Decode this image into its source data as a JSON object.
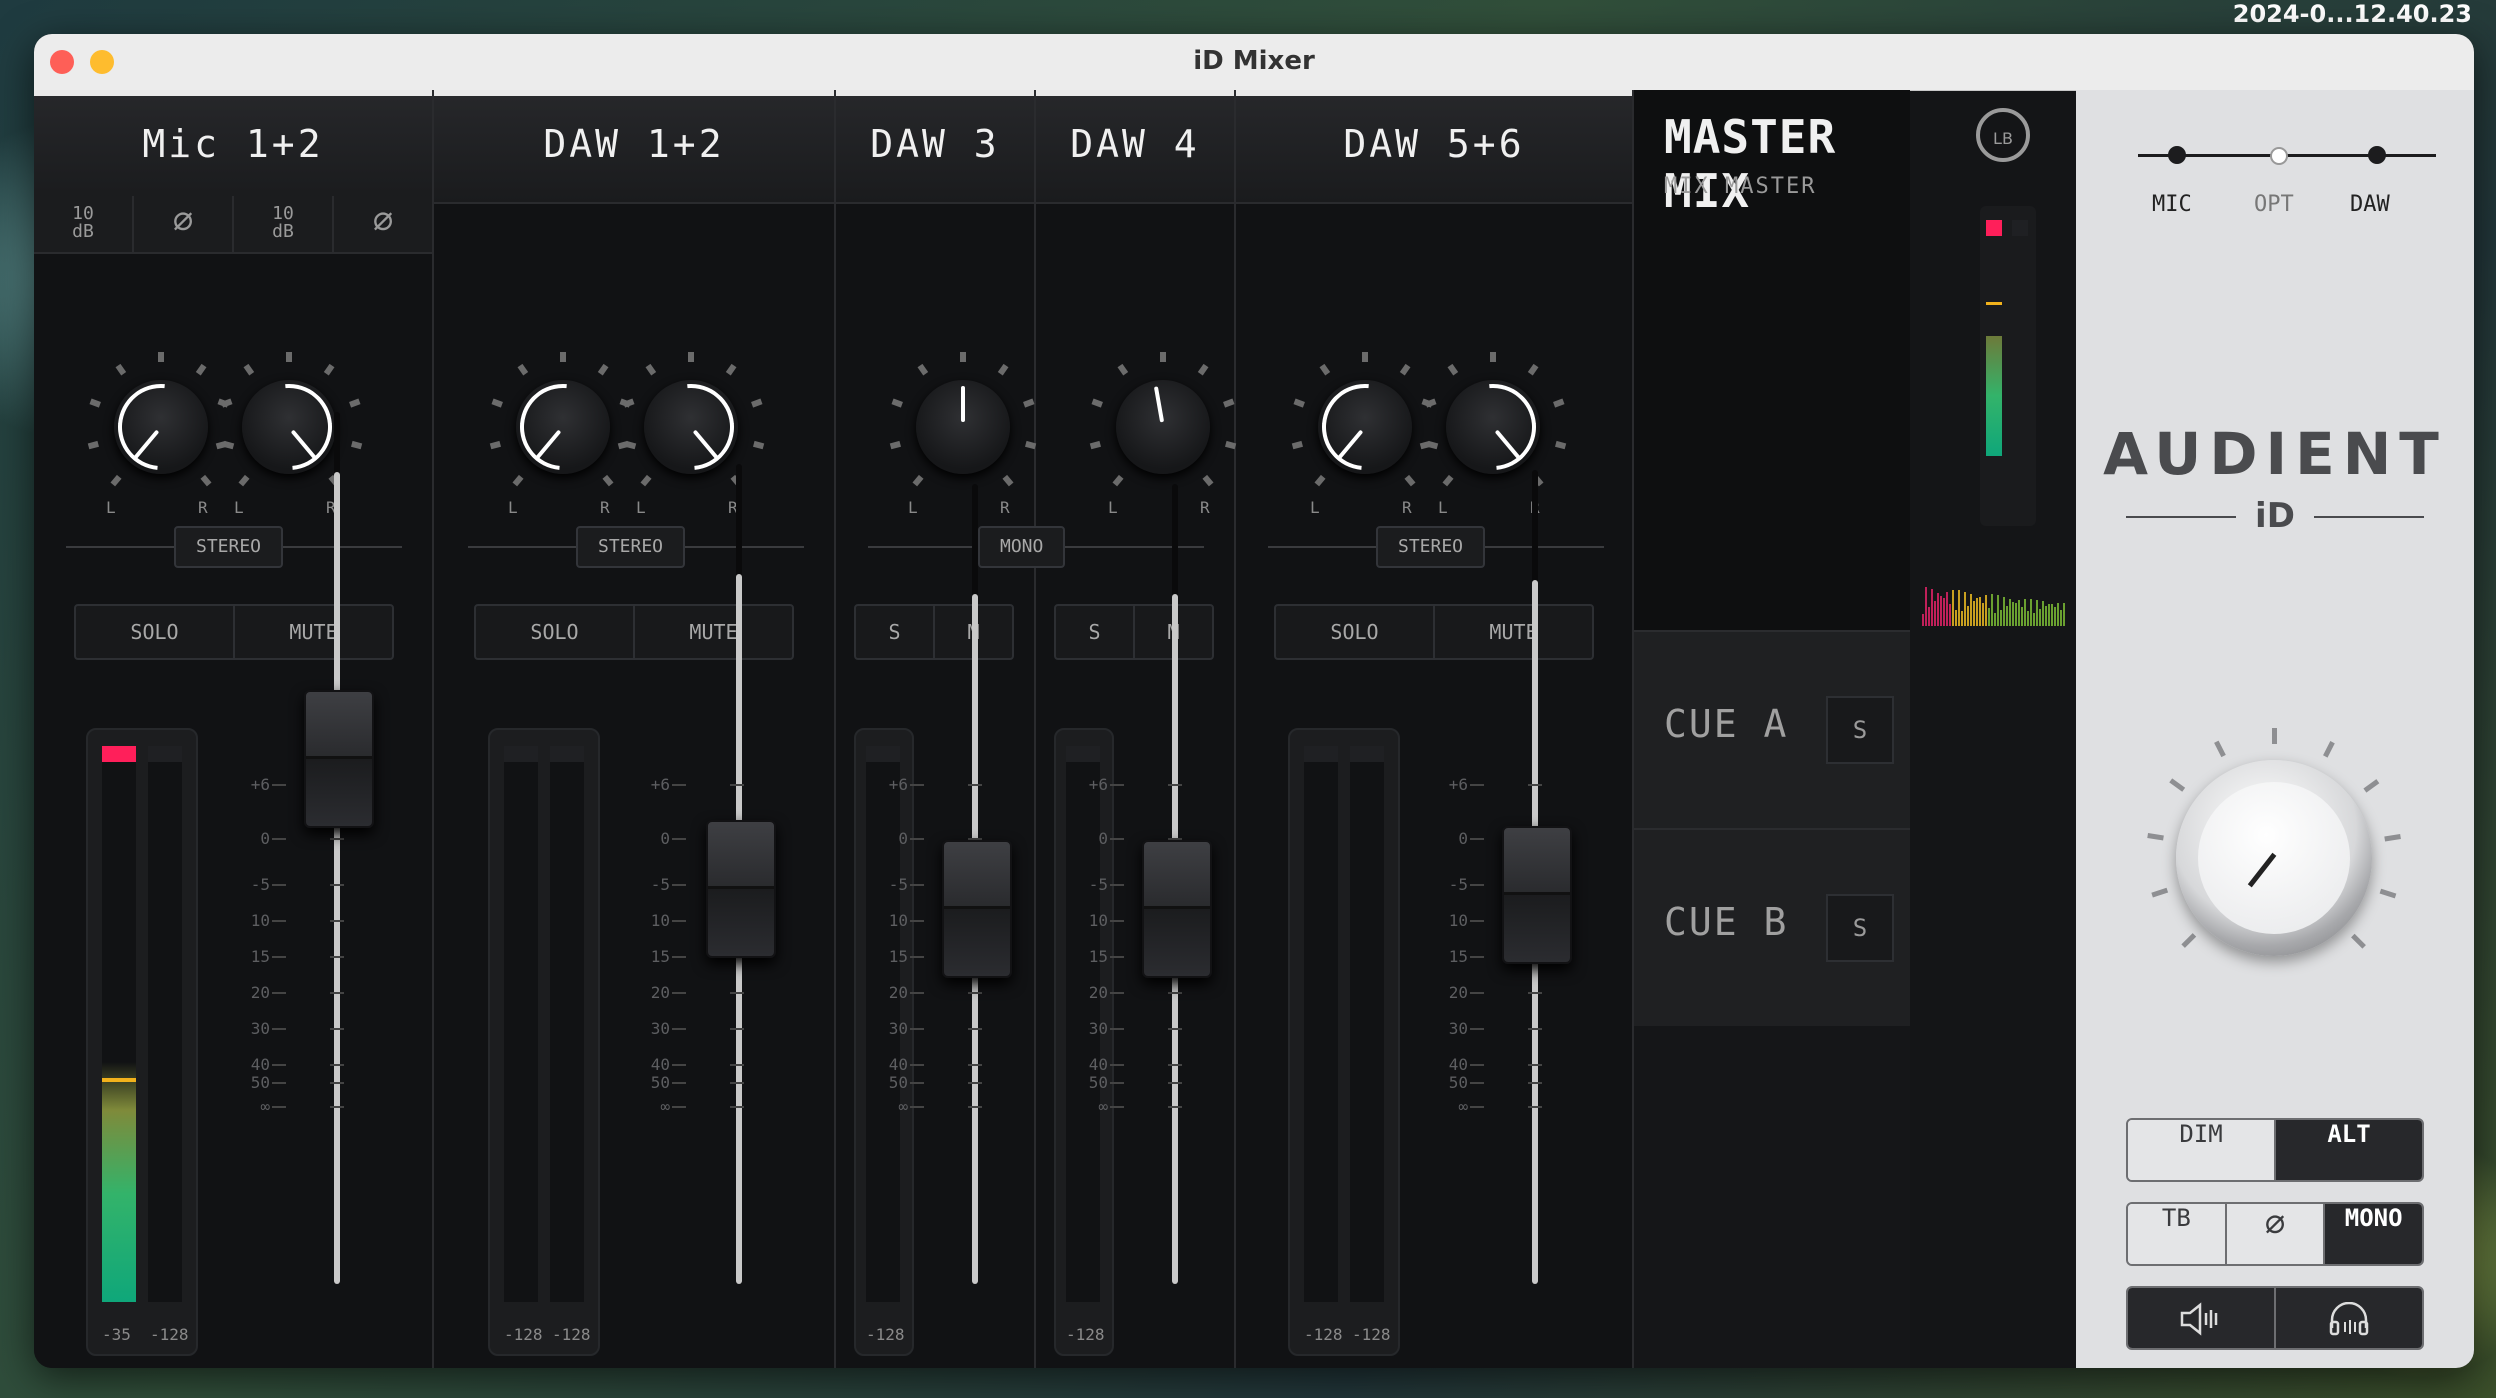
{
  "desktop": {
    "clock": "2024-0...12.40.23"
  },
  "window": {
    "title": "iD Mixer"
  },
  "channels": [
    {
      "name": "Mic 1+2",
      "pad_label": "10\ndB",
      "phase_icon": "∅",
      "mode": "STEREO",
      "solo": "SOLO",
      "mute": "MUTE",
      "meter_labels": [
        "-35",
        "-128"
      ],
      "pan_l": "L",
      "pan_r": "R"
    },
    {
      "name": "DAW 1+2",
      "mode": "STEREO",
      "solo": "SOLO",
      "mute": "MUTE",
      "meter_labels": [
        "-128",
        "-128"
      ],
      "pan_l": "L",
      "pan_r": "R"
    },
    {
      "name": "DAW 3",
      "mode": "MONO",
      "solo": "S",
      "mute": "M",
      "meter_labels": [
        "-128"
      ],
      "pan_l": "L",
      "pan_r": "R"
    },
    {
      "name": "DAW 4",
      "solo": "S",
      "mute": "M",
      "meter_labels": [
        "-128"
      ],
      "pan_l": "L",
      "pan_r": "R"
    },
    {
      "name": "DAW 5+6",
      "mode": "STEREO",
      "solo": "SOLO",
      "mute": "MUTE",
      "meter_labels": [
        "-128",
        "-128"
      ],
      "pan_l": "L",
      "pan_r": "R"
    }
  ],
  "fader_scale": [
    "+6",
    "0",
    "-5",
    "10",
    "15",
    "20",
    "30",
    "40",
    "50",
    "∞"
  ],
  "master": {
    "title": "MASTER MIX",
    "subtitle": "MIX MASTER",
    "loopback": "LB",
    "cues": [
      {
        "name": "CUE A",
        "solo": "S"
      },
      {
        "name": "CUE B",
        "solo": "S"
      }
    ]
  },
  "monitor": {
    "sources": [
      "MIC",
      "OPT",
      "DAW"
    ],
    "brand": "AUDIENT",
    "brand_sub": "iD",
    "dim": "DIM",
    "alt": "ALT",
    "tb": "TB",
    "phase": "∅",
    "mono": "MONO"
  },
  "colors": {
    "clip": "#ff1f5a",
    "peak": "#f2b21c",
    "meter_low": "#0fa77a"
  }
}
